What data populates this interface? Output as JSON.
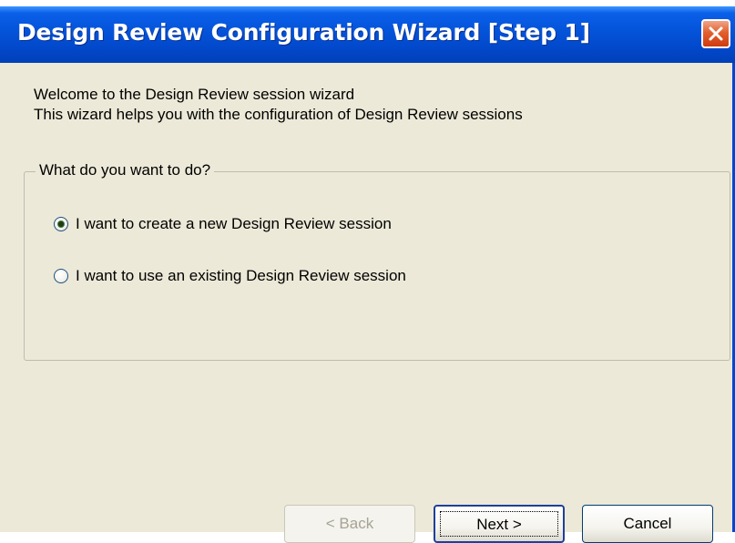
{
  "window": {
    "title": "Design Review Configuration Wizard [Step 1]"
  },
  "intro": {
    "line1": "Welcome to the Design Review session wizard",
    "line2": "This wizard helps you with the configuration of Design Review sessions"
  },
  "group": {
    "legend": "What do you want to do?",
    "options": [
      {
        "label": "I want to create a new Design Review session",
        "selected": true
      },
      {
        "label": "I want to use an existing Design Review session",
        "selected": false
      }
    ]
  },
  "buttons": {
    "back": "< Back",
    "next": "Next >",
    "cancel": "Cancel"
  },
  "icons": {
    "close": "close-icon"
  },
  "colors": {
    "titlebar": "#0453d9",
    "close": "#e2602d",
    "face": "#ece9d8"
  }
}
